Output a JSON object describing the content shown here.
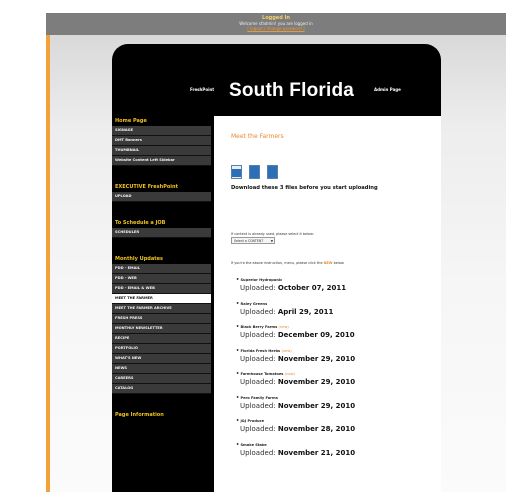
{
  "topbar": {
    "line1": "Logged In",
    "line2": "Welcome sfadmin! you are logged in",
    "line3": "[ logout / change password ]"
  },
  "banner": {
    "prefix": "FreshPoint",
    "title": "South Florida",
    "suffix": "Admin Page"
  },
  "sidebar": {
    "sections": [
      {
        "title": "Home Page",
        "items": [
          {
            "label": "SIGNAGE"
          },
          {
            "label": "DMT Banners"
          },
          {
            "label": "THUMBNAIL"
          },
          {
            "label": "Website Content Left Sidebar"
          }
        ]
      },
      {
        "title": "EXECUTIVE FreshPoint",
        "items": [
          {
            "label": "UPLOAD"
          }
        ]
      },
      {
        "title": "To Schedule a JOB",
        "items": [
          {
            "label": "SCHEDULER"
          }
        ]
      },
      {
        "title": "Monthly Updates",
        "items": [
          {
            "label": "PDD - EMAIL"
          },
          {
            "label": "PDD - WEB"
          },
          {
            "label": "PDD - EMAIL & WEB"
          },
          {
            "label": "MEET THE FARMER"
          },
          {
            "label": "MEET THE FARMER ARCHIVE"
          },
          {
            "label": "FRESH PRESS"
          },
          {
            "label": "MONTHLY NEWSLETTER"
          },
          {
            "label": "RECIPE"
          },
          {
            "label": "PORTFOLIO"
          },
          {
            "label": "WHAT'S NEW"
          },
          {
            "label": "NEWS"
          },
          {
            "label": "CAREERS"
          },
          {
            "label": "CATALOG"
          }
        ]
      },
      {
        "title": "Page Information",
        "items": []
      }
    ]
  },
  "content": {
    "title": "Meet the Farmers",
    "download_text": "Download these 3 files before you start uploading",
    "hint_select": "If content is already used, please select it below:",
    "select_value": "Select a CONTENT",
    "hint_upload_pre": "If you're the above instruction, menu, please click the",
    "hint_upload_hl": "NEW",
    "hint_upload_post": "below.",
    "farms": [
      {
        "name": "Superior Hydroponic",
        "new": "",
        "uploaded_label": "Uploaded:",
        "date": "October 07, 2011"
      },
      {
        "name": "Raley Greens",
        "new": "",
        "uploaded_label": "Uploaded:",
        "date": "April 29, 2011"
      },
      {
        "name": "Black Berry Farms",
        "new": "(new)",
        "uploaded_label": "Uploaded:",
        "date": "December 09, 2010"
      },
      {
        "name": "Florida Fresh Herbs",
        "new": "(new)",
        "uploaded_label": "Uploaded:",
        "date": "November 29, 2010"
      },
      {
        "name": "Farmhouse Tomatoes",
        "new": "(new)",
        "uploaded_label": "Uploaded:",
        "date": "November 29, 2010"
      },
      {
        "name": "Pero Family Farms",
        "new": "",
        "uploaded_label": "Uploaded:",
        "date": "November 29, 2010"
      },
      {
        "name": "J&J Produce",
        "new": "",
        "uploaded_label": "Uploaded:",
        "date": "November 28, 2010"
      },
      {
        "name": "Smoke Stake",
        "new": "",
        "uploaded_label": "Uploaded:",
        "date": "November 21, 2010"
      }
    ]
  },
  "colors": {
    "accent_orange": "#e8892e",
    "sidebar_heading": "#f0c21a",
    "topbar_gray": "#7d7d7d"
  }
}
